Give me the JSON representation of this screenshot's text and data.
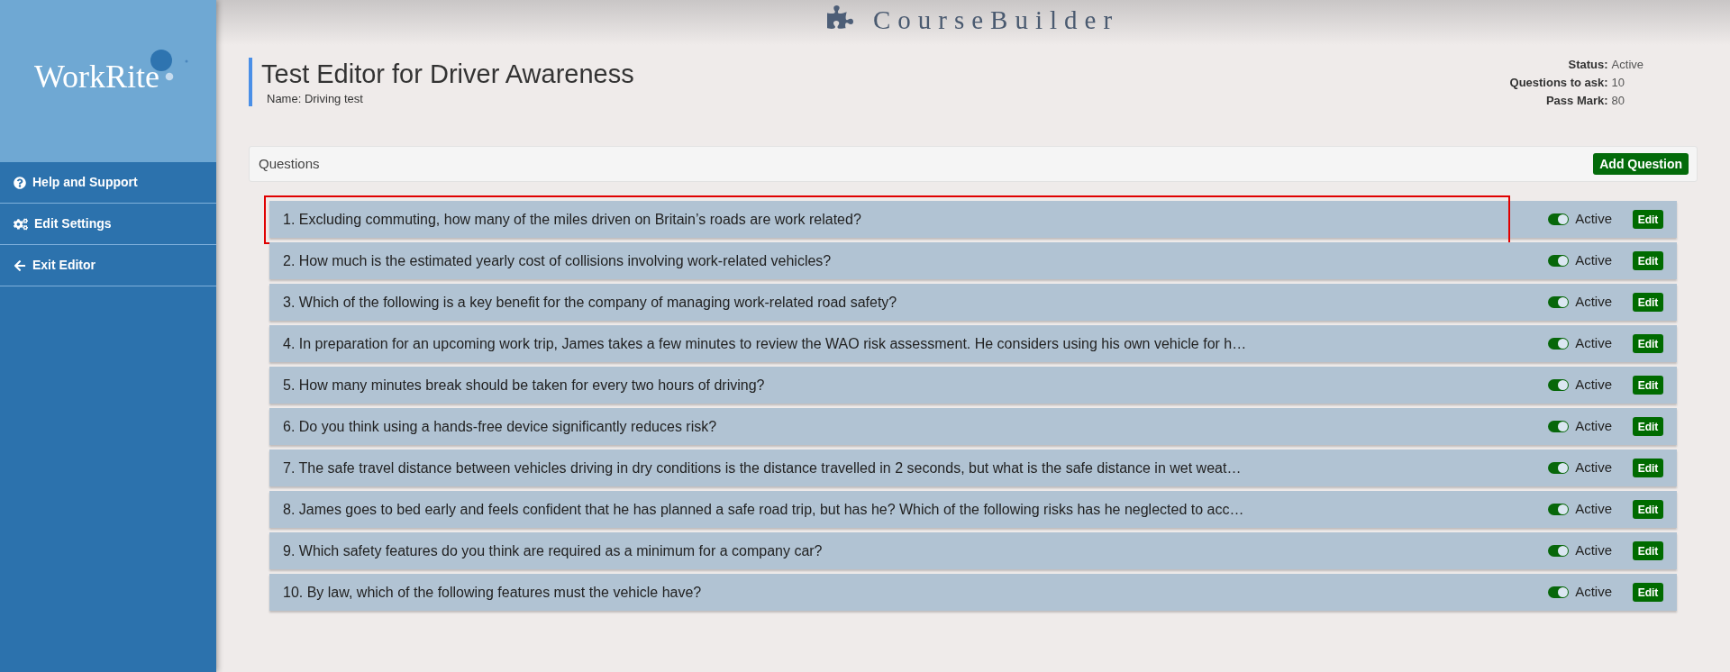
{
  "sidebar": {
    "logo": "WorkRite",
    "menu": [
      {
        "kind": "help",
        "label": "Help and Support"
      },
      {
        "kind": "settings",
        "label": "Edit Settings"
      },
      {
        "kind": "exit",
        "label": "Exit Editor"
      }
    ]
  },
  "header": {
    "app_title": "CourseBuilder"
  },
  "page": {
    "title": "Test Editor for Driver Awareness",
    "subtitle": "Name: Driving test"
  },
  "test_info": [
    {
      "label": "Status:",
      "value": "Active"
    },
    {
      "label": "Questions to ask:",
      "value": "10"
    },
    {
      "label": "Pass Mark:",
      "value": "80"
    }
  ],
  "questions_panel": {
    "title": "Questions",
    "add_button": "Add Question"
  },
  "questions": [
    {
      "text": "1. Excluding commuting, how many of the miles driven on Britain’s roads are work related?",
      "active": true,
      "status_label": "Active",
      "edit_button": "Edit",
      "highlighted": true
    },
    {
      "text": "2. How much is the estimated yearly cost of collisions involving work-related vehicles?",
      "active": true,
      "status_label": "Active",
      "edit_button": "Edit",
      "highlighted": false
    },
    {
      "text": "3. Which of the following is a key benefit for the company of managing work-related road safety?",
      "active": true,
      "status_label": "Active",
      "edit_button": "Edit",
      "highlighted": false
    },
    {
      "text": "4. In preparation for an upcoming work trip, James takes a few minutes to review the WAO risk assessment. He considers using his own vehicle for h…",
      "active": true,
      "status_label": "Active",
      "edit_button": "Edit",
      "highlighted": false
    },
    {
      "text": "5. How many minutes break should be taken for every two hours of driving?",
      "active": true,
      "status_label": "Active",
      "edit_button": "Edit",
      "highlighted": false
    },
    {
      "text": "6. Do you think using a hands-free device significantly reduces risk?",
      "active": true,
      "status_label": "Active",
      "edit_button": "Edit",
      "highlighted": false
    },
    {
      "text": "7. The safe travel distance between vehicles driving in dry conditions is the distance travelled in 2 seconds, but what is the safe distance in wet weat…",
      "active": true,
      "status_label": "Active",
      "edit_button": "Edit",
      "highlighted": false
    },
    {
      "text": "8. James goes to bed early and feels confident that he has planned a safe road trip, but has he? Which of the following risks has he neglected to acc…",
      "active": true,
      "status_label": "Active",
      "edit_button": "Edit",
      "highlighted": false
    },
    {
      "text": "9. Which safety features do you think are required as a minimum for a company car?",
      "active": true,
      "status_label": "Active",
      "edit_button": "Edit",
      "highlighted": false
    },
    {
      "text": "10. By law, which of the following features must the vehicle have?",
      "active": true,
      "status_label": "Active",
      "edit_button": "Edit",
      "highlighted": false
    }
  ]
}
